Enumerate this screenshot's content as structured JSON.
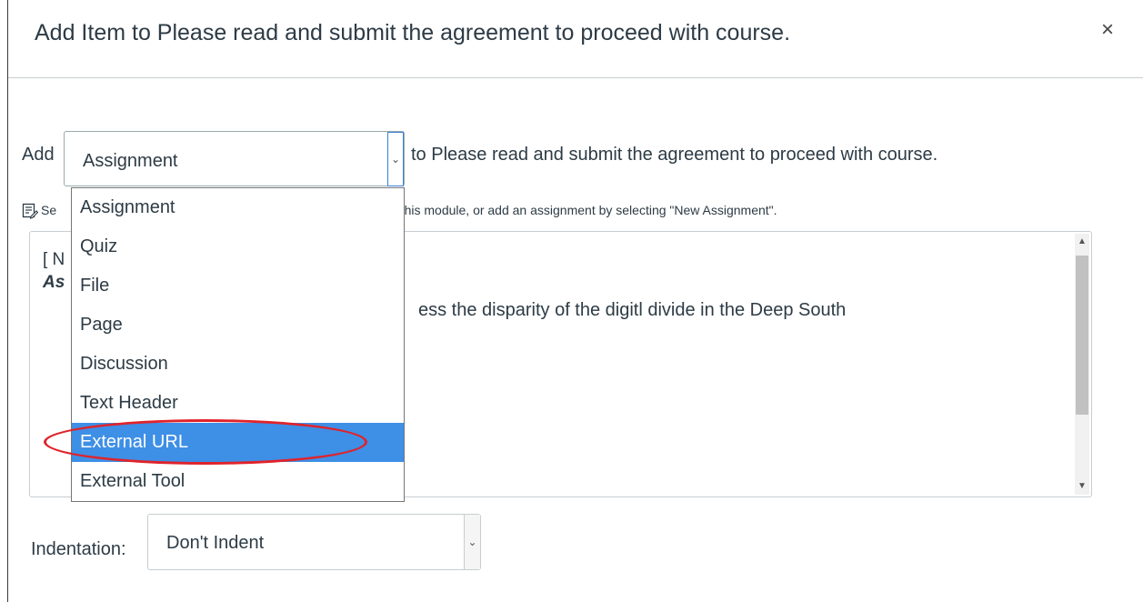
{
  "dialog": {
    "title": "Add Item to Please read and submit the agreement to proceed with course.",
    "close_glyph": "×"
  },
  "add_row": {
    "label": "Add",
    "selected_type": "Assignment",
    "suffix": "to Please read and submit the agreement to proceed with course."
  },
  "hint": {
    "prefix": "Se",
    "suffix": "th this module, or add an assignment by selecting \"New Assignment\".",
    "icon": "edit-note-icon"
  },
  "list": {
    "line1": "[ N",
    "line2": "As",
    "line3": "ess the disparity of the digitl divide in the Deep South"
  },
  "dropdown": {
    "options": [
      "Assignment",
      "Quiz",
      "File",
      "Page",
      "Discussion",
      "Text Header",
      "External URL",
      "External Tool"
    ],
    "highlighted": "External URL"
  },
  "indentation": {
    "label": "Indentation:",
    "value": "Don't Indent"
  },
  "colors": {
    "highlight": "#3e8fe6",
    "annotation": "#e0232a"
  }
}
